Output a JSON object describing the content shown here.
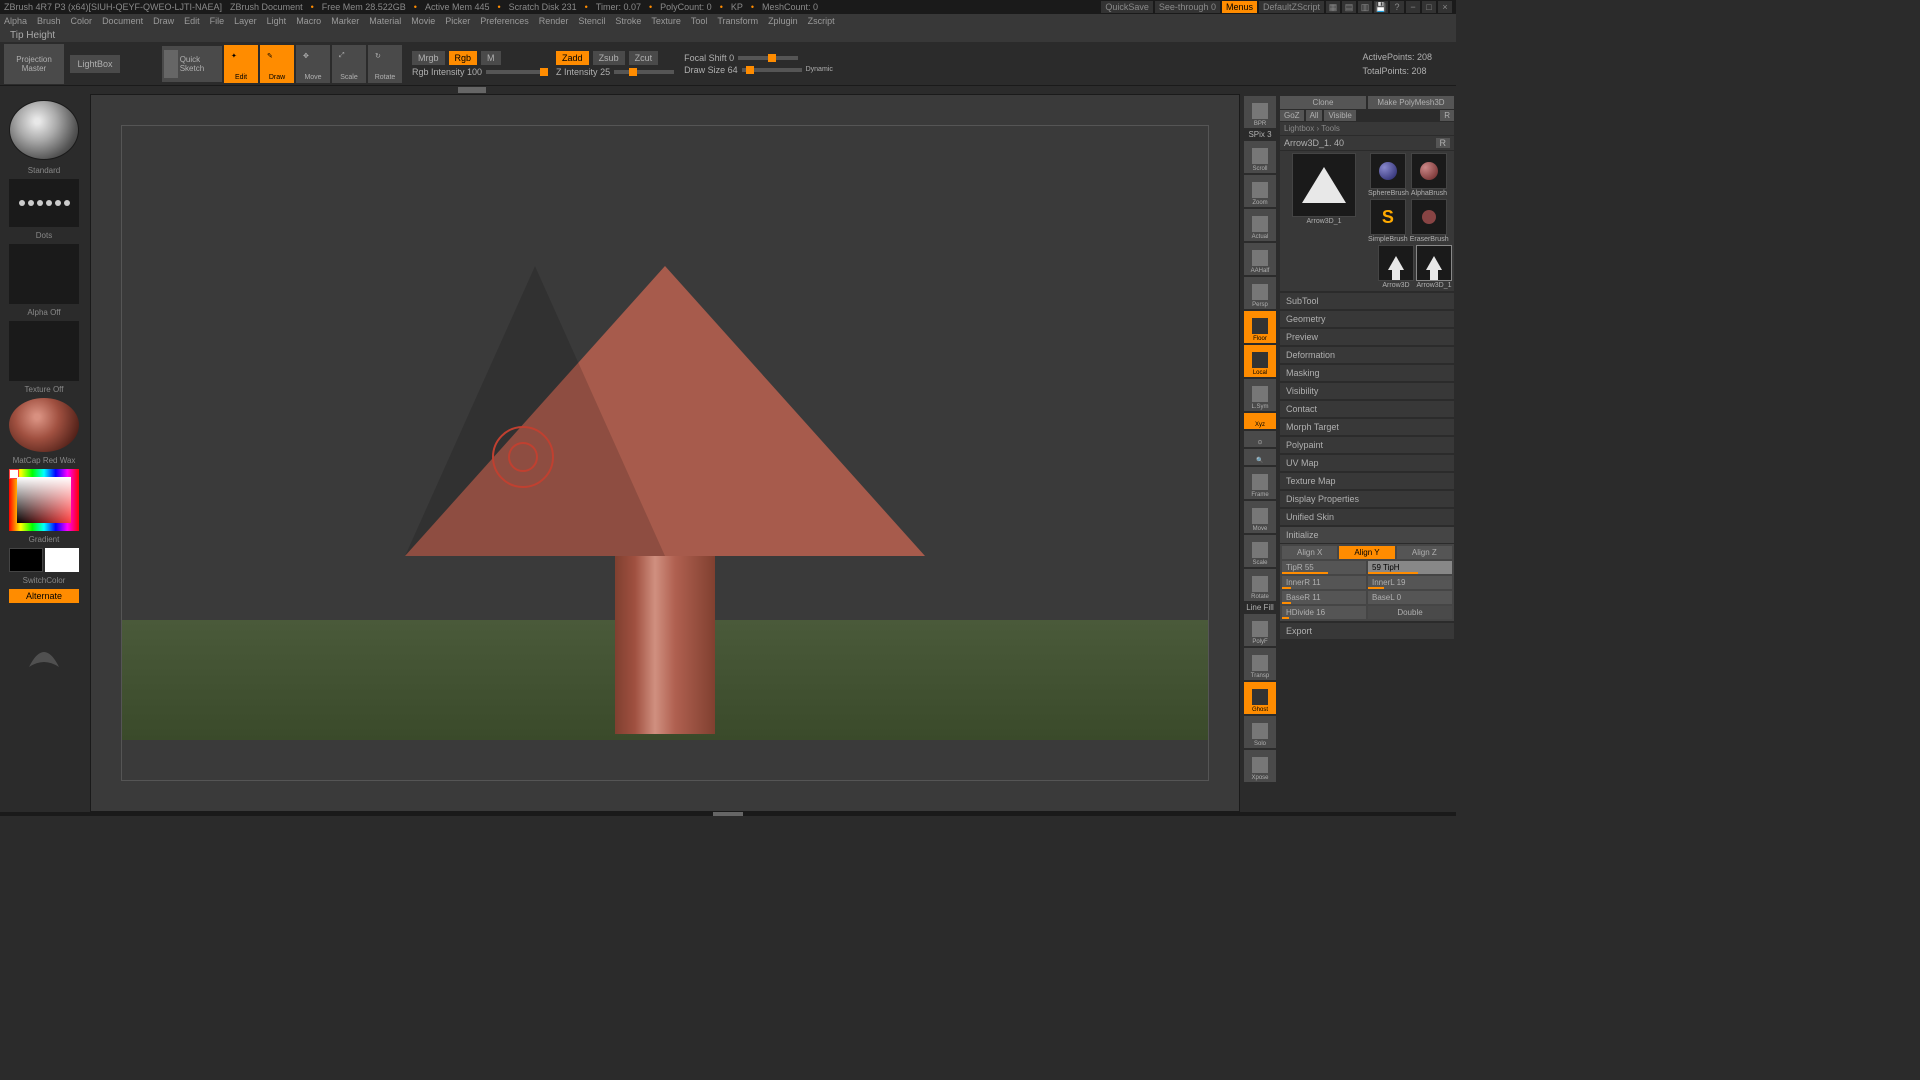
{
  "titlebar": {
    "app": "ZBrush 4R7 P3 (x64)[SIUH-QEYF-QWEO-LJTI-NAEA]",
    "doc": "ZBrush Document",
    "freemem": "Free Mem 28.522GB",
    "activemem": "Active Mem 445",
    "scratch": "Scratch Disk 231",
    "timer": "Timer: 0.07",
    "polycount": "PolyCount: 0",
    "kp": "KP",
    "meshcount": "MeshCount: 0",
    "quicksave": "QuickSave",
    "seethrough": "See-through  0",
    "menus": "Menus",
    "defaultscript": "DefaultZScript"
  },
  "menubar": [
    "Alpha",
    "Brush",
    "Color",
    "Document",
    "Draw",
    "Edit",
    "File",
    "Layer",
    "Light",
    "Macro",
    "Marker",
    "Material",
    "Movie",
    "Picker",
    "Preferences",
    "Render",
    "Stencil",
    "Stroke",
    "Texture",
    "Tool",
    "Transform",
    "Zplugin",
    "Zscript"
  ],
  "statusline": "Tip Height",
  "top": {
    "projection": "Projection Master",
    "lightbox": "LightBox",
    "quicksketch": "Quick Sketch",
    "edit": "Edit",
    "draw": "Draw",
    "move": "Move",
    "scale": "Scale",
    "rotate": "Rotate",
    "mrgb": "Mrgb",
    "rgb": "Rgb",
    "m": "M",
    "rgbintensity": "Rgb Intensity 100",
    "zadd": "Zadd",
    "zsub": "Zsub",
    "zcut": "Zcut",
    "zintensity": "Z Intensity 25",
    "focalshift": "Focal Shift 0",
    "drawsize": "Draw Size 64",
    "dynamic": "Dynamic",
    "activepoints": "ActivePoints: 208",
    "totalpoints": "TotalPoints: 208"
  },
  "left": {
    "brush": "Standard",
    "stroke": "Dots",
    "alpha": "Alpha Off",
    "texture": "Texture Off",
    "material": "MatCap Red Wax",
    "gradient": "Gradient",
    "switchcolor": "SwitchColor",
    "alternate": "Alternate"
  },
  "rightbtns": {
    "bpr": "BPR",
    "spix": "SPix 3",
    "scroll": "Scroll",
    "zoom": "Zoom",
    "actual": "Actual",
    "aahalf": "AAHalf",
    "persp": "Persp",
    "floor": "Floor",
    "local": "Local",
    "lsym": "L.Sym",
    "xyz": "Xyz",
    "frame": "Frame",
    "move": "Move",
    "scale": "Scale",
    "rotate": "Rotate",
    "linefill": "Line Fill",
    "polyf": "PolyF",
    "transp": "Transp",
    "ghost": "Ghost",
    "solo": "Solo",
    "xpose": "Xpose"
  },
  "right": {
    "clone": "Clone",
    "makepolymesh": "Make PolyMesh3D",
    "goz": "GoZ",
    "all": "All",
    "visible": "Visible",
    "r": "R",
    "breadcrumb": "Lightbox › Tools",
    "toolname": "Arrow3D_1. 40",
    "tools": [
      {
        "name": "Arrow3D_1"
      },
      {
        "name": "SphereBrush"
      },
      {
        "name": "SimpleBrush"
      },
      {
        "name": "AlphaBrush"
      },
      {
        "name": "EraserBrush"
      },
      {
        "name": "Arrow3D"
      },
      {
        "name": "Arrow3D_1"
      }
    ],
    "sections": [
      "SubTool",
      "Geometry",
      "Preview",
      "Deformation",
      "Masking",
      "Visibility",
      "Contact",
      "Morph Target",
      "Polypaint",
      "UV Map",
      "Texture Map",
      "Display Properties",
      "Unified Skin",
      "Initialize",
      "Export"
    ],
    "init": {
      "alignx": "Align X",
      "aligny": "Align Y",
      "alignz": "Align Z",
      "tipr": "TipR 55",
      "tiph": "59 TipH",
      "innerr": "InnerR 11",
      "innerl": "InnerL 19",
      "baser": "BaseR 11",
      "basel": "BaseL 0",
      "hdivide": "HDivide 16",
      "double": "Double"
    }
  }
}
